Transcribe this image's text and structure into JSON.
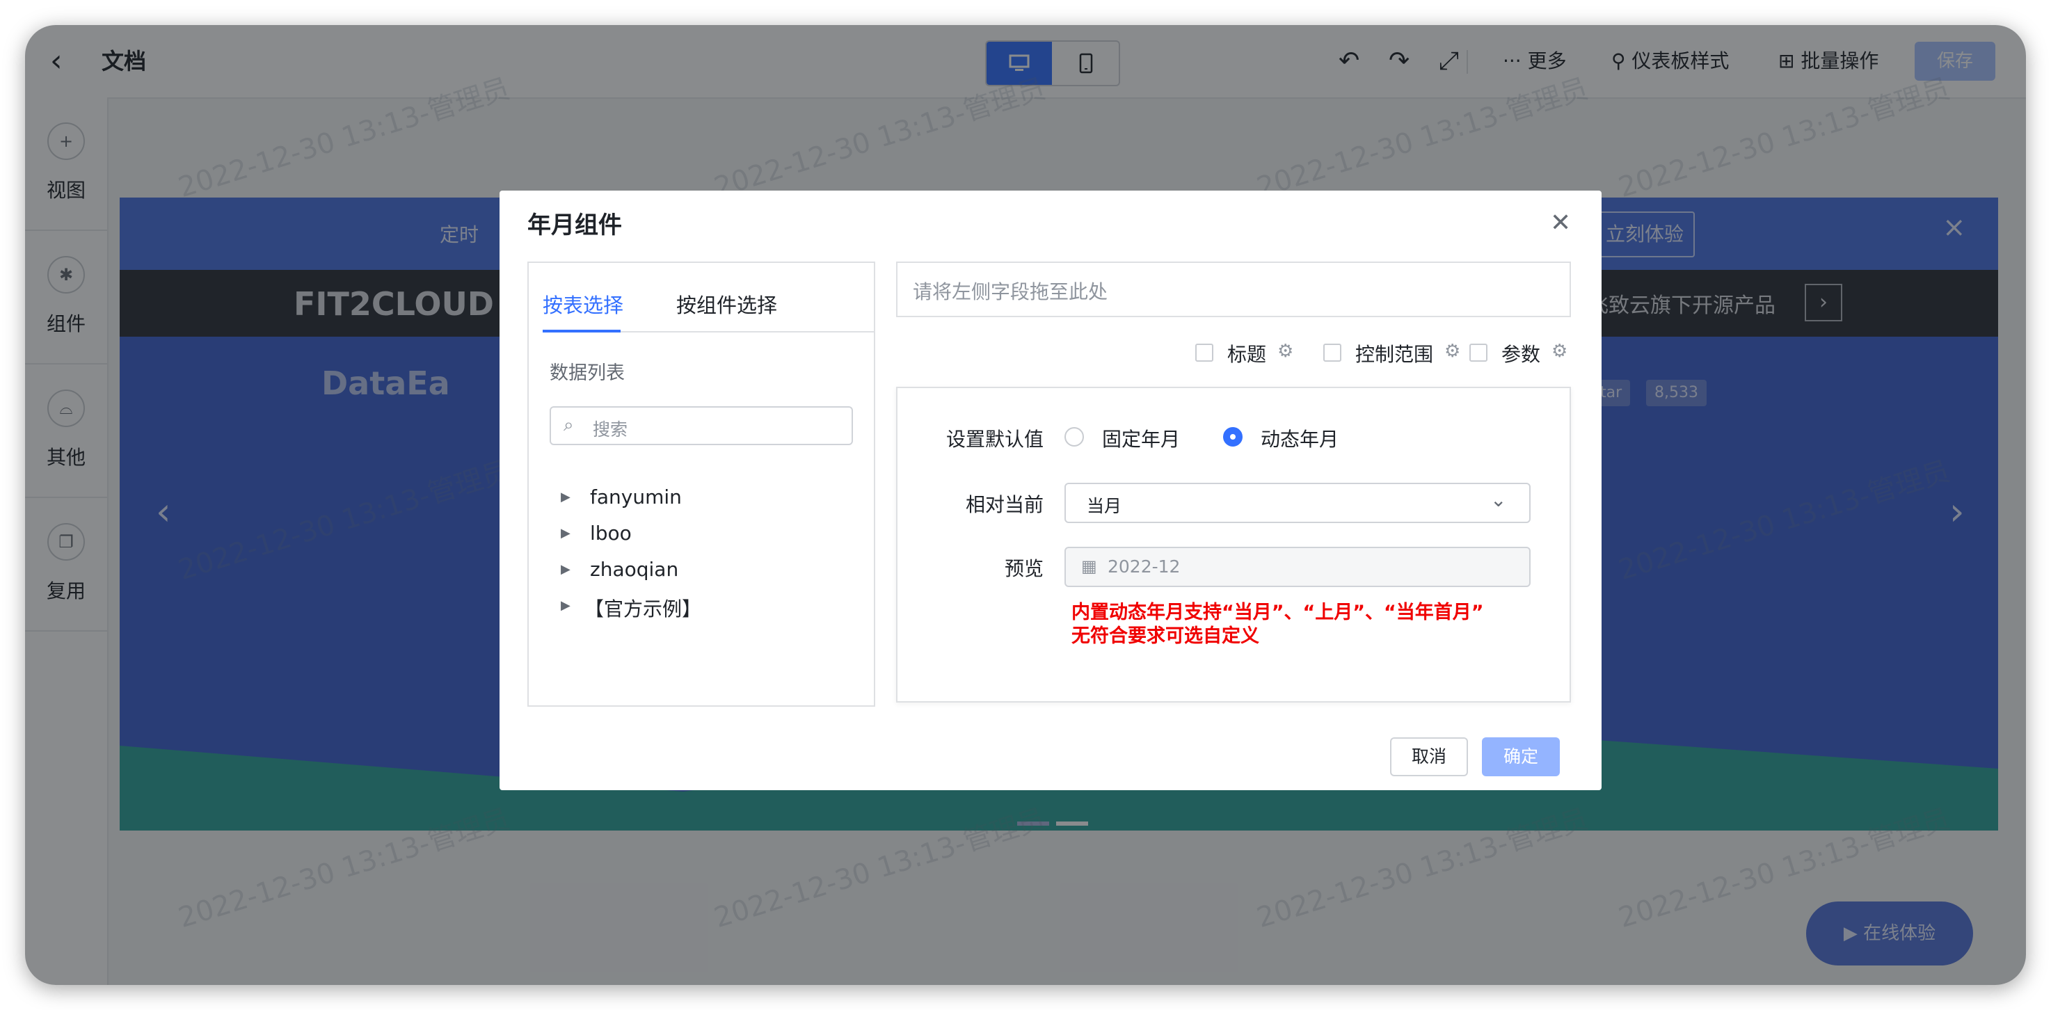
{
  "topbar": {
    "title": "文档",
    "more": "更多",
    "dashboard_style": "仪表板样式",
    "batch": "批量操作",
    "save": "保存"
  },
  "rail": {
    "items": [
      {
        "label": "视图",
        "icon": "plus-circle-icon"
      },
      {
        "label": "组件",
        "icon": "component-icon"
      },
      {
        "label": "其他",
        "icon": "other-icon"
      },
      {
        "label": "复用",
        "icon": "copy-icon"
      }
    ]
  },
  "canvas": {
    "strip_text": "定时",
    "strip_button": "立刻体验",
    "dark_logo": "FIT2CLOUD",
    "dark_text": "飞致云旗下开源产品",
    "banner_logo": "DataEa",
    "star_label": "Star",
    "star_count": "8,533",
    "online_button": "在线体验",
    "watermark": "2022-12-30 13:13-管理员"
  },
  "dialog": {
    "title": "年月组件",
    "tabs": [
      "按表选择",
      "按组件选择"
    ],
    "list_title": "数据列表",
    "search_placeholder": "搜索",
    "tree": [
      "fanyumin",
      "lboo",
      "zhaoqian",
      "【官方示例】"
    ],
    "drop_placeholder": "请将左侧字段拖至此处",
    "options": [
      "标题",
      "控制范围",
      "参数"
    ],
    "default_label": "设置默认值",
    "radio_fixed": "固定年月",
    "radio_dynamic": "动态年月",
    "relative_label": "相对当前",
    "relative_value": "当月",
    "preview_label": "预览",
    "preview_value": "2022-12",
    "hint_line1": "内置动态年月支持“当月”、“上月”、“当年首月”",
    "hint_line2": "无符合要求可选自定义",
    "cancel": "取消",
    "ok": "确定"
  },
  "colors": {
    "accent": "#3370ff",
    "hint": "#f00000"
  }
}
